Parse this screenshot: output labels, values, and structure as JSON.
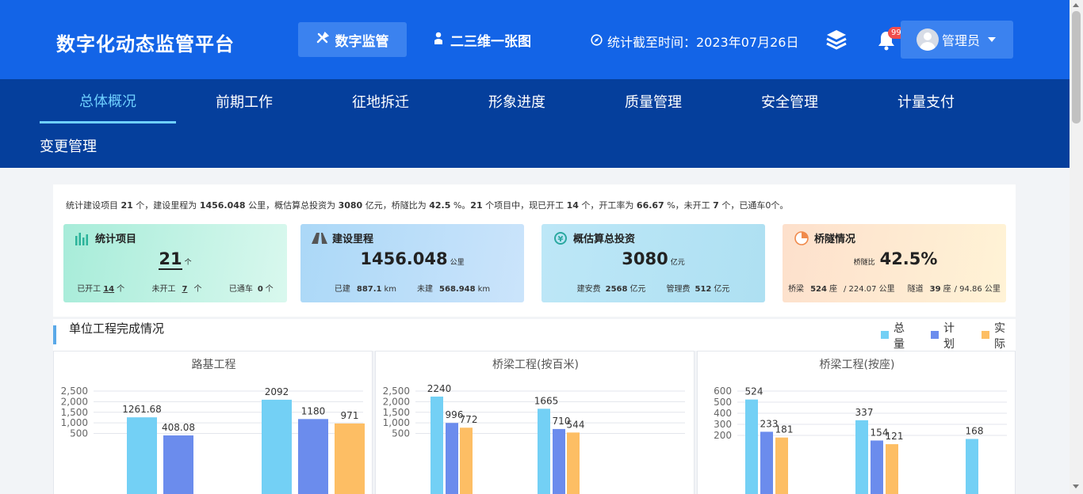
{
  "header": {
    "title": "数字化动态监管平台",
    "btn_digital": "数字监管",
    "btn_map": "二三维一张图",
    "stat_time": "统计截至时间：2023年07月26日",
    "badge": "99+",
    "user_name": "管理员"
  },
  "nav": {
    "items": [
      "总体概况",
      "前期工作",
      "征地拆迁",
      "形象进度",
      "质量管理",
      "安全管理",
      "计量支付",
      "变更管理"
    ]
  },
  "summary": {
    "p1": "统计建设项目 ",
    "n1": "21",
    "p2": " 个，建设里程为 ",
    "n2": "1456.048",
    "p3": " 公里，概估算总投资为 ",
    "n3": "3080",
    "p4": " 亿元，桥隧比为 ",
    "n4": "42.5",
    "p5": " %。",
    "n5": "21",
    "p6": " 个项目中，现已开工 ",
    "n6": "14",
    "p7": " 个，开工率为 ",
    "n7": "66.67",
    "p8": " %，未开工 ",
    "n8": "7",
    "p9": " 个，已通车0个。"
  },
  "cards": {
    "projects": {
      "title": "统计项目",
      "value": "21",
      "unit": "个",
      "s1_label": "已开工",
      "s1_value": "14",
      "s1_unit": "个",
      "s2_label": "未开工",
      "s2_value": "7",
      "s2_unit": "个",
      "s3_label": "已通车",
      "s3_value": "0",
      "s3_unit": "个"
    },
    "mileage": {
      "title": "建设里程",
      "value": "1456.048",
      "unit": "公里",
      "s1_label": "已建",
      "s1_value": "887.1",
      "s1_unit": "km",
      "s2_label": "未建",
      "s2_value": "568.948",
      "s2_unit": "km"
    },
    "investment": {
      "title": "概估算总投资",
      "value": "3080",
      "unit": "亿元",
      "s1_label": "建安费",
      "s1_value": "2568",
      "s1_unit": "亿元",
      "s2_label": "管理费",
      "s2_value": "512",
      "s2_unit": "亿元"
    },
    "bridge": {
      "title": "桥隧情况",
      "pre": "桥隧比",
      "value": "42.5%",
      "s1_label": "桥梁",
      "s1_value": "524",
      "s1_unit": "座",
      "s1_extra": "/ 224.07 公里",
      "s2_label": "隧道",
      "s2_value": "39",
      "s2_unit": "座",
      "s2_extra": "/ 94.86 公里"
    }
  },
  "section": {
    "title": "单位工程完成情况",
    "legend": [
      "总量",
      "计划",
      "实际"
    ]
  },
  "colors": {
    "total": "#73d0f5",
    "plan": "#6b8ced",
    "actual": "#fdbe64"
  },
  "chart_data": [
    {
      "type": "bar",
      "title": "路基工程",
      "ylim": [
        0,
        2500
      ],
      "yticks": [
        "500",
        "1,000",
        "1,500",
        "2,000",
        "2,500"
      ],
      "series": [
        {
          "name": "总量",
          "values": [
            1261.68,
            2092
          ]
        },
        {
          "name": "计划",
          "values": [
            408.08,
            1180
          ]
        },
        {
          "name": "实际",
          "values": [
            null,
            971
          ]
        }
      ],
      "labels": [
        [
          "1261.68",
          "408.08",
          ""
        ],
        [
          "2092",
          "1180",
          "971"
        ]
      ]
    },
    {
      "type": "bar",
      "title": "桥梁工程(按百米)",
      "ylim": [
        0,
        2500
      ],
      "yticks": [
        "500",
        "1,000",
        "1,500",
        "2,000",
        "2,500"
      ],
      "series": [
        {
          "name": "总量",
          "values": [
            2240,
            1665
          ]
        },
        {
          "name": "计划",
          "values": [
            996,
            710
          ]
        },
        {
          "name": "实际",
          "values": [
            772,
            544
          ]
        }
      ],
      "labels": [
        [
          "2240",
          "996",
          "772"
        ],
        [
          "1665",
          "710",
          "544"
        ]
      ]
    },
    {
      "type": "bar",
      "title": "桥梁工程(按座)",
      "ylim": [
        0,
        600
      ],
      "yticks": [
        "200",
        "300",
        "400",
        "500",
        "600"
      ],
      "series": [
        {
          "name": "总量",
          "values": [
            524,
            337,
            168
          ]
        },
        {
          "name": "计划",
          "values": [
            233,
            154,
            null
          ]
        },
        {
          "name": "实际",
          "values": [
            181,
            121,
            null
          ]
        }
      ],
      "labels": [
        [
          "524",
          "233",
          "181"
        ],
        [
          "337",
          "154",
          "121"
        ],
        [
          "168",
          "",
          ""
        ]
      ]
    }
  ]
}
